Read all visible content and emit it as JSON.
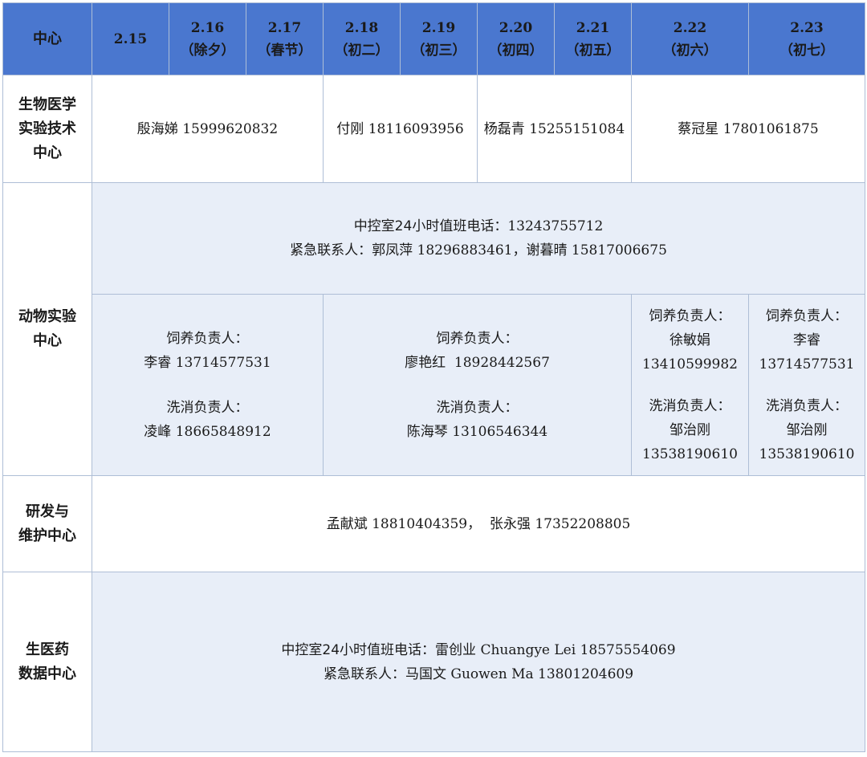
{
  "header": {
    "label": "中心",
    "dates": [
      {
        "date": "2.15",
        "note": ""
      },
      {
        "date": "2.16",
        "note": "（除夕）"
      },
      {
        "date": "2.17",
        "note": "（春节）"
      },
      {
        "date": "2.18",
        "note": "（初二）"
      },
      {
        "date": "2.19",
        "note": "（初三）"
      },
      {
        "date": "2.20",
        "note": "（初四）"
      },
      {
        "date": "2.21",
        "note": "（初五）"
      },
      {
        "date": "2.22",
        "note": "（初六）"
      },
      {
        "date": "2.23",
        "note": "（初七）"
      }
    ]
  },
  "biomed": {
    "name_line1": "生物医学",
    "name_line2": "实验技术",
    "name_line3": "中心",
    "duties": [
      {
        "person": "殷海娣",
        "phone": "15999620832"
      },
      {
        "person": "付刚",
        "phone": "18116093956"
      },
      {
        "person": "杨磊青",
        "phone": "15255151084"
      },
      {
        "person": "蔡冠星",
        "phone": "17801061875"
      }
    ]
  },
  "animal": {
    "name_line1": "动物实验",
    "name_line2": "中心",
    "control_line": "中控室24小时值班电话：",
    "control_phone": "13243755712",
    "emergency_line": "紧急联系人：郭凤萍",
    "emergency_phone1": "18296883461",
    "emergency_sep": "，谢暮晴",
    "emergency_phone2": "15817006675",
    "groups": [
      {
        "feed_label": "饲养负责人：",
        "feed_person": "李睿",
        "feed_phone": "13714577531",
        "wash_label": "洗消负责人：",
        "wash_person": "凌峰",
        "wash_phone": "18665848912"
      },
      {
        "feed_label": "饲养负责人：",
        "feed_person": "廖艳红",
        "feed_phone": "18928442567",
        "wash_label": "洗消负责人：",
        "wash_person": "陈海琴",
        "wash_phone": "13106546344"
      },
      {
        "feed_label": "饲养负责人：",
        "feed_person": "徐敏娟",
        "feed_phone": "13410599982",
        "wash_label": "洗消负责人：",
        "wash_person": "邹治刚",
        "wash_phone": "13538190610"
      },
      {
        "feed_label": "饲养负责人：",
        "feed_person": "李睿",
        "feed_phone": "13714577531",
        "wash_label": "洗消负责人：",
        "wash_person": "邹治刚",
        "wash_phone": "13538190610"
      }
    ]
  },
  "rnd": {
    "name_line1": "研发与",
    "name_line2": "维护中心",
    "person1": "孟献斌",
    "phone1": "18810404359",
    "sep": "，",
    "person2": "张永强",
    "phone2": "17352208805"
  },
  "pharma": {
    "name_line1": "生医药",
    "name_line2": "数据中心",
    "control_line": "中控室24小时值班电话：雷创业",
    "control_name_en": "Chuangye Lei",
    "control_phone": "18575554069",
    "emergency_line": "紧急联系人：马国文",
    "emergency_name_en": "Guowen Ma",
    "emergency_phone": "13801204609"
  }
}
